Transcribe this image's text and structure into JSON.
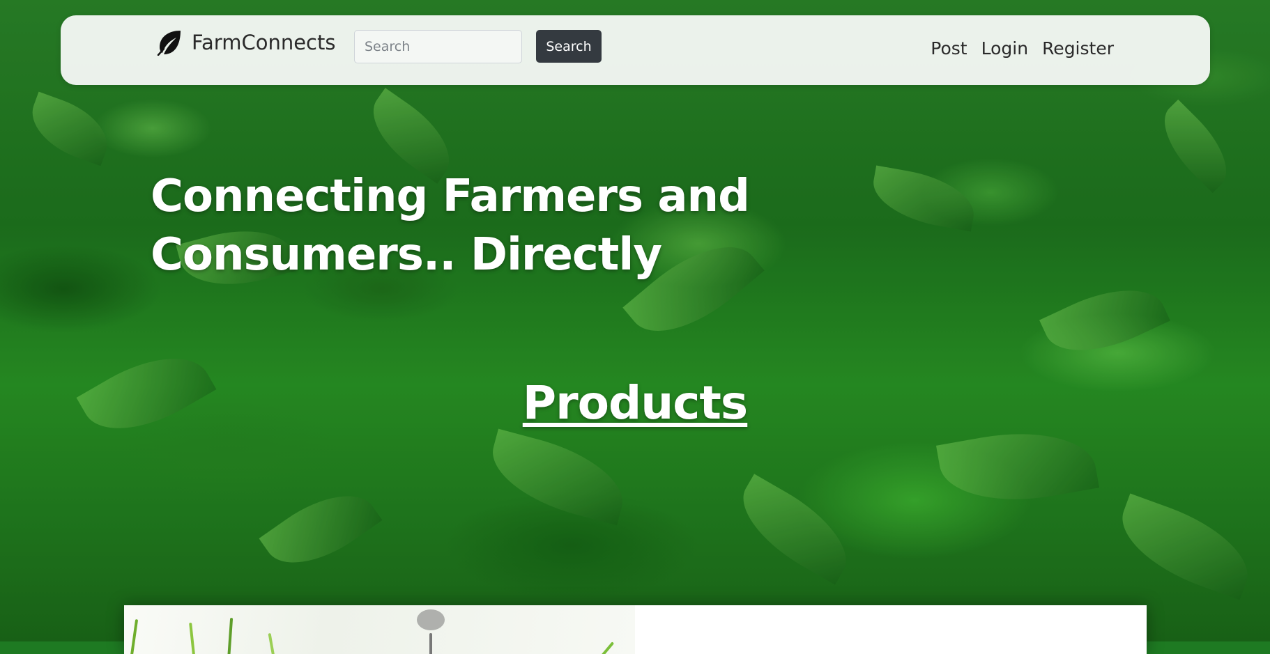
{
  "brand": {
    "name": "FarmConnects",
    "icon": "leaf-icon"
  },
  "search": {
    "placeholder": "Search",
    "value": "",
    "button_label": "Search"
  },
  "nav": {
    "links": [
      {
        "label": "Post"
      },
      {
        "label": "Login"
      },
      {
        "label": "Register"
      }
    ]
  },
  "hero": {
    "title": "Connecting Farmers and Consumers.. Directly"
  },
  "products": {
    "heading": "Products"
  },
  "colors": {
    "nav_background": "#f4f7f4",
    "search_button": "#343a40",
    "hero_text": "#ffffff",
    "background_green": "#1e7a22"
  }
}
